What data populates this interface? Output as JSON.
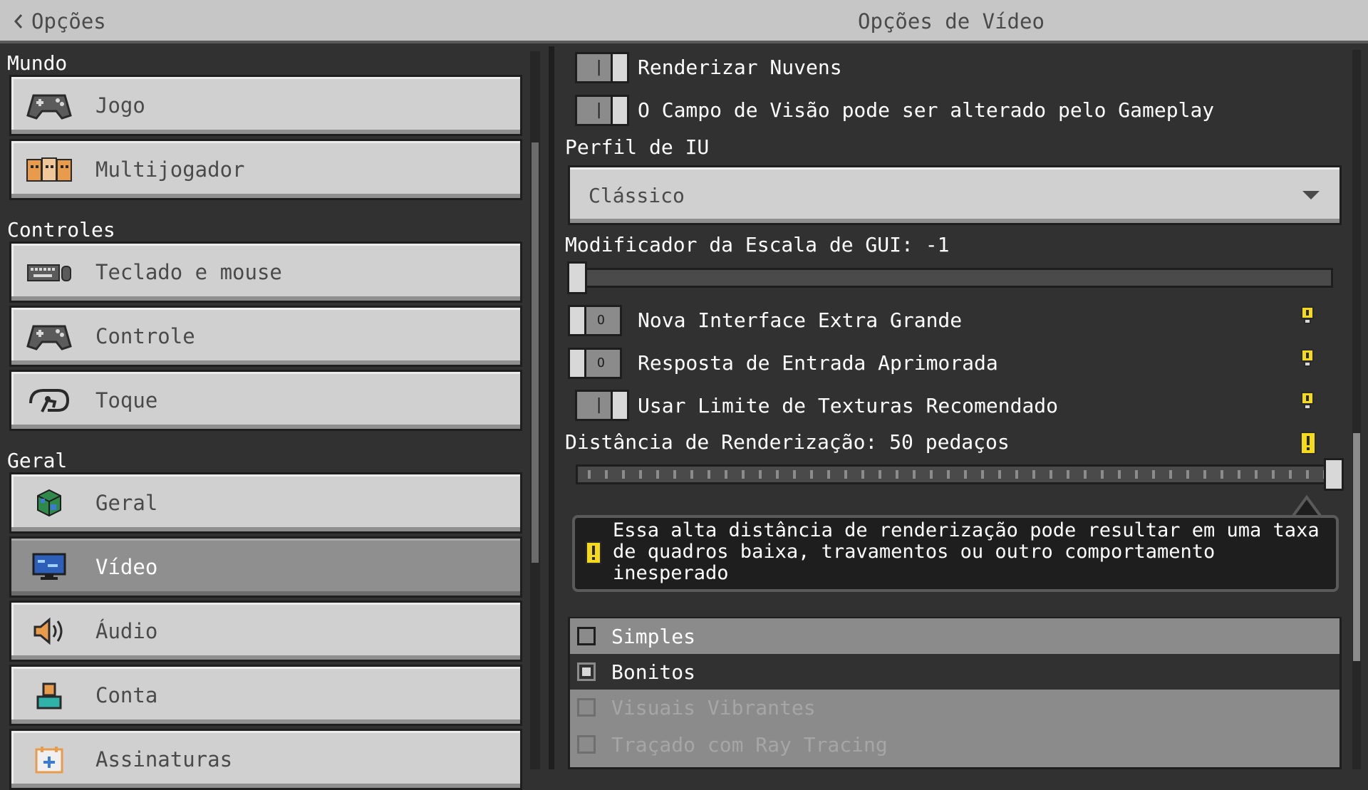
{
  "header": {
    "back_label": "Opções",
    "title": "Opções de Vídeo"
  },
  "sidebar": {
    "sections": [
      {
        "title": "Mundo"
      },
      {
        "title": "Controles"
      },
      {
        "title": "Geral"
      }
    ],
    "items": [
      {
        "label": "Jogo",
        "icon": "gamepad-icon"
      },
      {
        "label": "Multijogador",
        "icon": "players-icon"
      },
      {
        "label": "Teclado e mouse",
        "icon": "keyboard-mouse-icon"
      },
      {
        "label": "Controle",
        "icon": "controller-icon"
      },
      {
        "label": "Toque",
        "icon": "touch-icon"
      },
      {
        "label": "Geral",
        "icon": "globe-icon"
      },
      {
        "label": "Vídeo",
        "icon": "monitor-icon",
        "selected": true
      },
      {
        "label": "Áudio",
        "icon": "speaker-icon"
      },
      {
        "label": "Conta",
        "icon": "account-icon"
      },
      {
        "label": "Assinaturas",
        "icon": "subscriptions-icon"
      }
    ]
  },
  "settings": {
    "render_clouds": {
      "label": "Renderizar Nuvens",
      "on": true
    },
    "fov_gameplay": {
      "label": "O Campo de Visão pode ser alterado pelo Gameplay",
      "on": true
    },
    "ui_profile": {
      "label": "Perfil de IU",
      "value": "Clássico"
    },
    "gui_scale": {
      "label": "Modificador da Escala de GUI: -1",
      "value": -1
    },
    "extra_large_ui": {
      "label": "Nova Interface Extra Grande",
      "on": false,
      "off_mark": "O"
    },
    "input_response": {
      "label": "Resposta de Entrada Aprimorada",
      "on": false,
      "off_mark": "O"
    },
    "texture_limit": {
      "label": "Usar Limite de Texturas Recomendado",
      "on": true
    },
    "render_distance": {
      "label": "Distância de Renderização: 50 pedaços",
      "value": 50
    },
    "warning": {
      "text": "Essa alta distância de renderização pode resultar em uma taxa de quadros baixa, travamentos ou outro comportamento inesperado"
    },
    "graphics_modes": [
      {
        "label": "Simples",
        "selected": false,
        "enabled": true
      },
      {
        "label": "Bonitos",
        "selected": true,
        "enabled": true
      },
      {
        "label": "Visuais Vibrantes",
        "selected": false,
        "enabled": false
      },
      {
        "label": "Traçado com Ray Tracing",
        "selected": false,
        "enabled": false
      }
    ]
  },
  "colors": {
    "background": "#313131",
    "button": "#d0d0d0",
    "selected_button": "#8f8f8f",
    "warning_yellow": "#f5d91c"
  }
}
